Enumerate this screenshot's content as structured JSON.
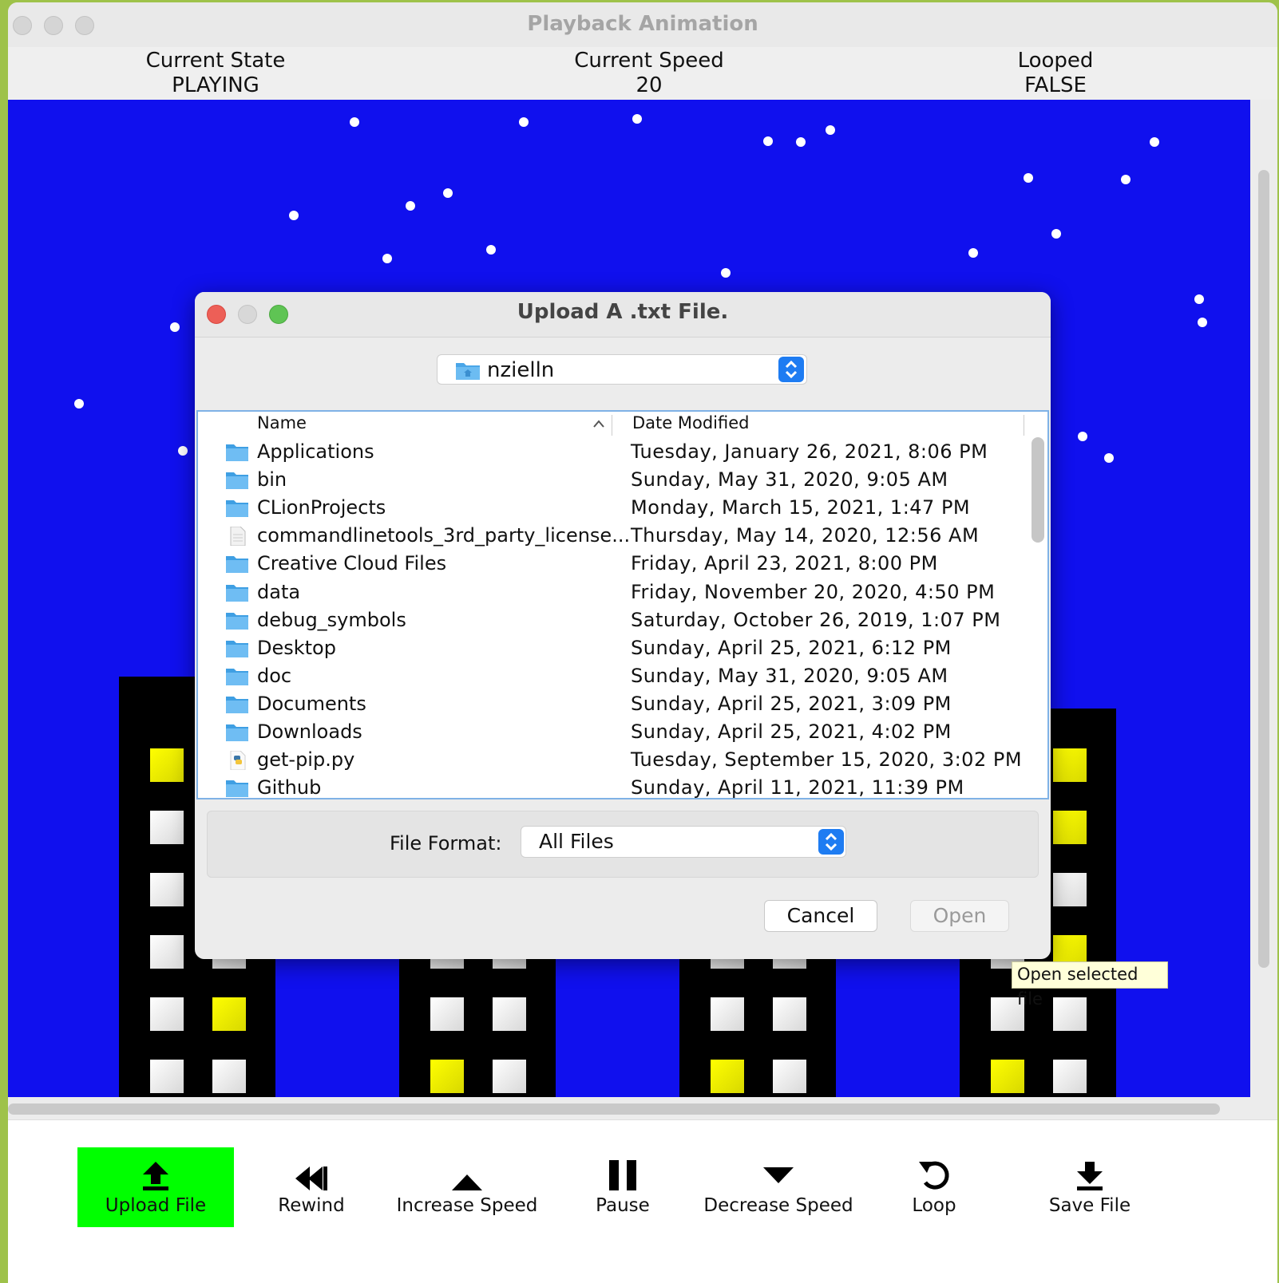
{
  "window": {
    "title": "Playback Animation"
  },
  "status": {
    "state_label": "Current State",
    "state_value": "PLAYING",
    "speed_label": "Current Speed",
    "speed_value": "20",
    "looped_label": "Looped",
    "looped_value": "FALSE"
  },
  "colors": {
    "sky": "#1010ee",
    "window_yellow": "#ffff00",
    "active_button": "#00ff00",
    "accent": "#1e7cf2"
  },
  "toolbar": {
    "buttons": [
      {
        "label": "Upload File",
        "icon": "upload-icon"
      },
      {
        "label": "Rewind",
        "icon": "rewind-icon"
      },
      {
        "label": "Increase Speed",
        "icon": "triangle-up-icon"
      },
      {
        "label": "Pause",
        "icon": "pause-icon"
      },
      {
        "label": "Decrease Speed",
        "icon": "triangle-down-icon"
      },
      {
        "label": "Loop",
        "icon": "loop-icon"
      },
      {
        "label": "Save File",
        "icon": "download-icon"
      }
    ]
  },
  "dialog": {
    "title": "Upload A .txt File.",
    "folder": "nzielln",
    "columns": {
      "name": "Name",
      "date": "Date Modified"
    },
    "files": [
      {
        "name": "Applications",
        "date": "Tuesday, January 26, 2021, 8:06 PM",
        "icon": "folder-icon"
      },
      {
        "name": "bin",
        "date": "Sunday, May 31, 2020, 9:05 AM",
        "icon": "folder-icon"
      },
      {
        "name": "CLionProjects",
        "date": "Monday, March 15, 2021, 1:47 PM",
        "icon": "folder-icon"
      },
      {
        "name": "commandlinetools_3rd_party_license...",
        "date": "Thursday, May 14, 2020, 12:56 AM",
        "icon": "document-icon"
      },
      {
        "name": "Creative Cloud Files",
        "date": "Friday, April 23, 2021, 8:00 PM",
        "icon": "folder-icon"
      },
      {
        "name": "data",
        "date": "Friday, November 20, 2020, 4:50 PM",
        "icon": "folder-icon"
      },
      {
        "name": "debug_symbols",
        "date": "Saturday, October 26, 2019, 1:07 PM",
        "icon": "folder-icon"
      },
      {
        "name": "Desktop",
        "date": "Sunday, April 25, 2021, 6:12 PM",
        "icon": "folder-icon"
      },
      {
        "name": "doc",
        "date": "Sunday, May 31, 2020, 9:05 AM",
        "icon": "folder-icon"
      },
      {
        "name": "Documents",
        "date": "Sunday, April 25, 2021, 3:09 PM",
        "icon": "folder-icon"
      },
      {
        "name": "Downloads",
        "date": "Sunday, April 25, 2021, 4:02 PM",
        "icon": "folder-icon"
      },
      {
        "name": "get-pip.py",
        "date": "Tuesday, September 15, 2020, 3:02 PM",
        "icon": "python-file-icon"
      },
      {
        "name": "Github",
        "date": "Sunday, April 11, 2021, 11:39 PM",
        "icon": "folder-icon"
      }
    ],
    "format_label": "File Format:",
    "format_value": "All Files",
    "cancel_label": "Cancel",
    "open_label": "Open"
  },
  "tooltip": "Open selected file"
}
